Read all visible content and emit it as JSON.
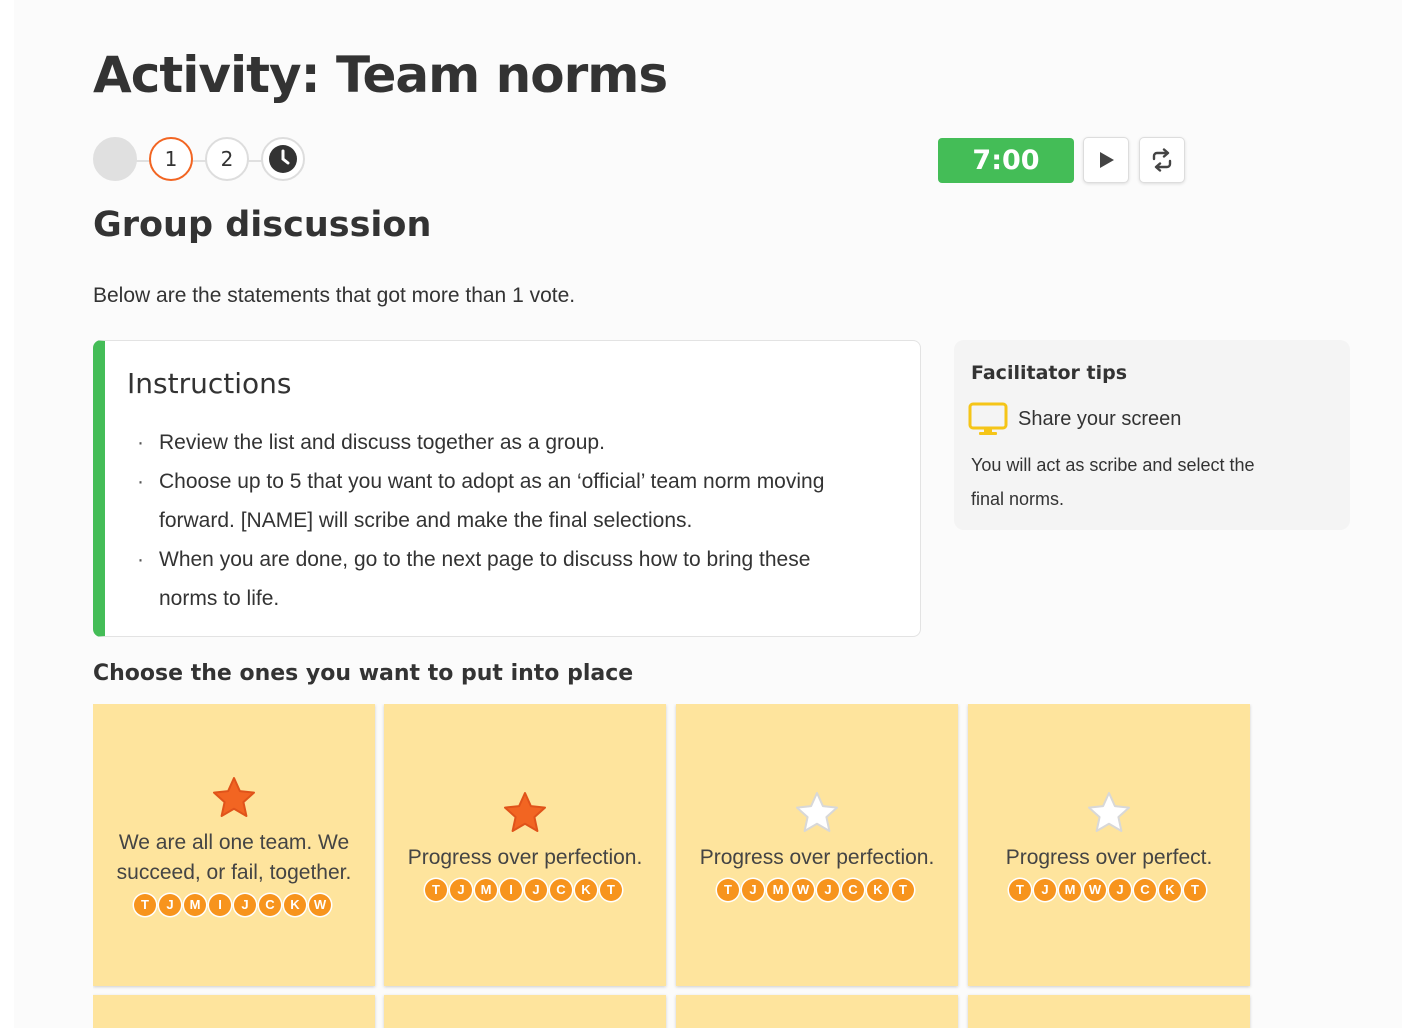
{
  "page": {
    "title": "Activity: Team norms",
    "section_title": "Group discussion",
    "lead": "Below are the statements that got more than 1 vote."
  },
  "steps": [
    {
      "label": "",
      "state": "start"
    },
    {
      "label": "1",
      "state": "active"
    },
    {
      "label": "2",
      "state": "default"
    },
    {
      "label": "",
      "icon": "clock-icon",
      "state": "default"
    }
  ],
  "timer": {
    "value": "7:00",
    "color": "#44bd57"
  },
  "controls": {
    "play_icon": "play-icon",
    "restart_icon": "repeat-icon"
  },
  "instructions": {
    "title": "Instructions",
    "items": [
      "Review the list and discuss together as a group.",
      "Choose up to 5 that you want to adopt as an ‘official’ team norm moving forward. [NAME] will scribe and make the final selections.",
      "When you are done, go to the next page to discuss how to bring these norms to life."
    ],
    "accent_color": "#44bd57"
  },
  "tips": {
    "title": "Facilitator tips",
    "share_icon": "monitor-icon",
    "share_label": "Share your screen",
    "body": "You will act as scribe and select the final norms."
  },
  "choose_title": "Choose the ones you want to put into place",
  "cards": [
    {
      "text": "We are all one team. We succeed, or fail, together.",
      "starred": true,
      "voters": [
        "T",
        "J",
        "M",
        "I",
        "J",
        "C",
        "K",
        "W"
      ]
    },
    {
      "text": "Progress over perfection.",
      "starred": true,
      "voters": [
        "T",
        "J",
        "M",
        "I",
        "J",
        "C",
        "K",
        "T"
      ]
    },
    {
      "text": "Progress over perfection.",
      "starred": false,
      "voters": [
        "T",
        "J",
        "M",
        "W",
        "J",
        "C",
        "K",
        "T"
      ]
    },
    {
      "text": "Progress over perfect.",
      "starred": false,
      "voters": [
        "T",
        "J",
        "M",
        "W",
        "J",
        "C",
        "K",
        "T"
      ]
    }
  ],
  "colors": {
    "card_bg": "#fee49d",
    "star_filled": "#f26522",
    "avatar": "#f7941d",
    "active_step": "#f26522"
  }
}
